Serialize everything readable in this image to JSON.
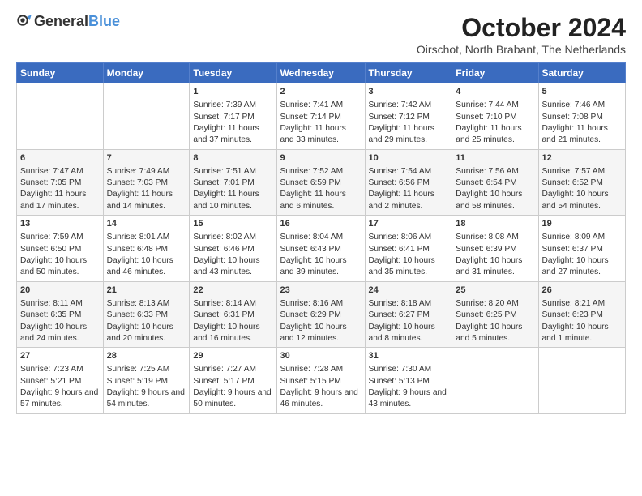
{
  "header": {
    "logo_general": "General",
    "logo_blue": "Blue",
    "month_title": "October 2024",
    "location": "Oirschot, North Brabant, The Netherlands"
  },
  "days_of_week": [
    "Sunday",
    "Monday",
    "Tuesday",
    "Wednesday",
    "Thursday",
    "Friday",
    "Saturday"
  ],
  "weeks": [
    [
      {
        "day": "",
        "content": ""
      },
      {
        "day": "",
        "content": ""
      },
      {
        "day": "1",
        "content": "Sunrise: 7:39 AM\nSunset: 7:17 PM\nDaylight: 11 hours and 37 minutes."
      },
      {
        "day": "2",
        "content": "Sunrise: 7:41 AM\nSunset: 7:14 PM\nDaylight: 11 hours and 33 minutes."
      },
      {
        "day": "3",
        "content": "Sunrise: 7:42 AM\nSunset: 7:12 PM\nDaylight: 11 hours and 29 minutes."
      },
      {
        "day": "4",
        "content": "Sunrise: 7:44 AM\nSunset: 7:10 PM\nDaylight: 11 hours and 25 minutes."
      },
      {
        "day": "5",
        "content": "Sunrise: 7:46 AM\nSunset: 7:08 PM\nDaylight: 11 hours and 21 minutes."
      }
    ],
    [
      {
        "day": "6",
        "content": "Sunrise: 7:47 AM\nSunset: 7:05 PM\nDaylight: 11 hours and 17 minutes."
      },
      {
        "day": "7",
        "content": "Sunrise: 7:49 AM\nSunset: 7:03 PM\nDaylight: 11 hours and 14 minutes."
      },
      {
        "day": "8",
        "content": "Sunrise: 7:51 AM\nSunset: 7:01 PM\nDaylight: 11 hours and 10 minutes."
      },
      {
        "day": "9",
        "content": "Sunrise: 7:52 AM\nSunset: 6:59 PM\nDaylight: 11 hours and 6 minutes."
      },
      {
        "day": "10",
        "content": "Sunrise: 7:54 AM\nSunset: 6:56 PM\nDaylight: 11 hours and 2 minutes."
      },
      {
        "day": "11",
        "content": "Sunrise: 7:56 AM\nSunset: 6:54 PM\nDaylight: 10 hours and 58 minutes."
      },
      {
        "day": "12",
        "content": "Sunrise: 7:57 AM\nSunset: 6:52 PM\nDaylight: 10 hours and 54 minutes."
      }
    ],
    [
      {
        "day": "13",
        "content": "Sunrise: 7:59 AM\nSunset: 6:50 PM\nDaylight: 10 hours and 50 minutes."
      },
      {
        "day": "14",
        "content": "Sunrise: 8:01 AM\nSunset: 6:48 PM\nDaylight: 10 hours and 46 minutes."
      },
      {
        "day": "15",
        "content": "Sunrise: 8:02 AM\nSunset: 6:46 PM\nDaylight: 10 hours and 43 minutes."
      },
      {
        "day": "16",
        "content": "Sunrise: 8:04 AM\nSunset: 6:43 PM\nDaylight: 10 hours and 39 minutes."
      },
      {
        "day": "17",
        "content": "Sunrise: 8:06 AM\nSunset: 6:41 PM\nDaylight: 10 hours and 35 minutes."
      },
      {
        "day": "18",
        "content": "Sunrise: 8:08 AM\nSunset: 6:39 PM\nDaylight: 10 hours and 31 minutes."
      },
      {
        "day": "19",
        "content": "Sunrise: 8:09 AM\nSunset: 6:37 PM\nDaylight: 10 hours and 27 minutes."
      }
    ],
    [
      {
        "day": "20",
        "content": "Sunrise: 8:11 AM\nSunset: 6:35 PM\nDaylight: 10 hours and 24 minutes."
      },
      {
        "day": "21",
        "content": "Sunrise: 8:13 AM\nSunset: 6:33 PM\nDaylight: 10 hours and 20 minutes."
      },
      {
        "day": "22",
        "content": "Sunrise: 8:14 AM\nSunset: 6:31 PM\nDaylight: 10 hours and 16 minutes."
      },
      {
        "day": "23",
        "content": "Sunrise: 8:16 AM\nSunset: 6:29 PM\nDaylight: 10 hours and 12 minutes."
      },
      {
        "day": "24",
        "content": "Sunrise: 8:18 AM\nSunset: 6:27 PM\nDaylight: 10 hours and 8 minutes."
      },
      {
        "day": "25",
        "content": "Sunrise: 8:20 AM\nSunset: 6:25 PM\nDaylight: 10 hours and 5 minutes."
      },
      {
        "day": "26",
        "content": "Sunrise: 8:21 AM\nSunset: 6:23 PM\nDaylight: 10 hours and 1 minute."
      }
    ],
    [
      {
        "day": "27",
        "content": "Sunrise: 7:23 AM\nSunset: 5:21 PM\nDaylight: 9 hours and 57 minutes."
      },
      {
        "day": "28",
        "content": "Sunrise: 7:25 AM\nSunset: 5:19 PM\nDaylight: 9 hours and 54 minutes."
      },
      {
        "day": "29",
        "content": "Sunrise: 7:27 AM\nSunset: 5:17 PM\nDaylight: 9 hours and 50 minutes."
      },
      {
        "day": "30",
        "content": "Sunrise: 7:28 AM\nSunset: 5:15 PM\nDaylight: 9 hours and 46 minutes."
      },
      {
        "day": "31",
        "content": "Sunrise: 7:30 AM\nSunset: 5:13 PM\nDaylight: 9 hours and 43 minutes."
      },
      {
        "day": "",
        "content": ""
      },
      {
        "day": "",
        "content": ""
      }
    ]
  ]
}
